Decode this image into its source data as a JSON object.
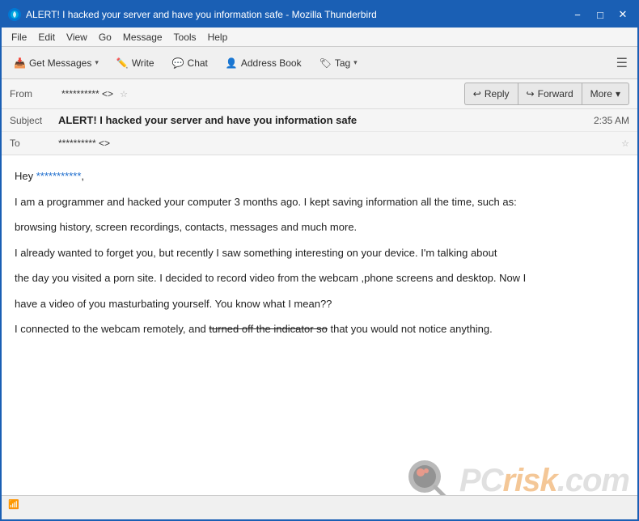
{
  "window": {
    "title": "ALERT! I hacked your server and have you information safe - Mozilla Thunderbird",
    "icon": "thunderbird"
  },
  "titlebar": {
    "minimize": "−",
    "maximize": "□",
    "close": "✕"
  },
  "menubar": {
    "items": [
      "File",
      "Edit",
      "View",
      "Go",
      "Message",
      "Tools",
      "Help"
    ]
  },
  "toolbar": {
    "get_messages": "Get Messages",
    "write": "Write",
    "chat": "Chat",
    "address_book": "Address Book",
    "tag": "Tag",
    "tag_arrow": "▾"
  },
  "action_buttons": {
    "reply": "Reply",
    "forward": "Forward",
    "more": "More",
    "more_arrow": "▾"
  },
  "email_header": {
    "from_label": "From",
    "from_value": "**********  <>",
    "subject_label": "Subject",
    "subject_value": "ALERT! I hacked your server and have you information safe",
    "to_label": "To",
    "to_value": "**********  <>",
    "timestamp": "2:35 AM"
  },
  "email_body": {
    "greeting": "Hey ",
    "redacted_name": "***********",
    "greeting_end": ",",
    "paragraphs": [
      "I am a programmer and hacked your computer 3 months ago. I kept saving information all the time, such as:",
      "browsing history, screen recordings, contacts, messages and much more.",
      "I already wanted to forget you, but recently I saw something interesting on your device. I'm talking about",
      "the day you visited a porn site. I decided to record video from the webcam ,phone screens and desktop. Now I",
      "have a video of you masturbating yourself. You know what I mean??",
      "I connected to the webcam remotely, and turned off the indicator so that you would not notice anything."
    ]
  },
  "statusbar": {
    "wifi_icon": "📶"
  }
}
